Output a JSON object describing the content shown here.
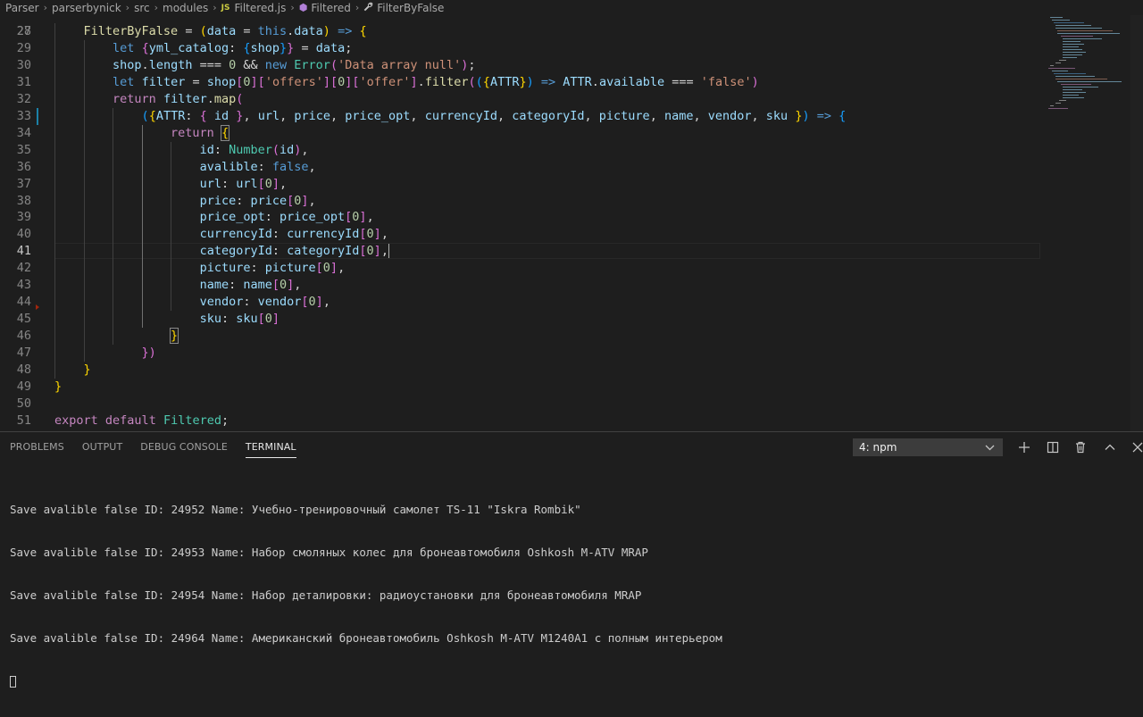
{
  "breadcrumb": {
    "items": [
      "Parser",
      "parserbynick",
      "src",
      "modules"
    ],
    "file_badge": "JS",
    "file": "Filtered.js",
    "class": "Filtered",
    "method": "FilterByFalse"
  },
  "editor": {
    "first_line_number": "27",
    "lines": [
      {
        "n": "28",
        "tokens": [
          [
            "p",
            "    "
          ],
          [
            "fn",
            "FilterByFalse"
          ],
          [
            "p",
            " = "
          ],
          [
            "br1",
            "("
          ],
          [
            "var",
            "data"
          ],
          [
            "p",
            " = "
          ],
          [
            "kw",
            "this"
          ],
          [
            "p",
            "."
          ],
          [
            "var",
            "data"
          ],
          [
            "br1",
            ")"
          ],
          [
            "p",
            " "
          ],
          [
            "kw",
            "=>"
          ],
          [
            "p",
            " "
          ],
          [
            "br1",
            "{"
          ]
        ]
      },
      {
        "n": "29",
        "tokens": [
          [
            "p",
            "        "
          ],
          [
            "kw",
            "let"
          ],
          [
            "p",
            " "
          ],
          [
            "br2",
            "{"
          ],
          [
            "var",
            "yml_catalog"
          ],
          [
            "p",
            ": "
          ],
          [
            "br3",
            "{"
          ],
          [
            "var",
            "shop"
          ],
          [
            "br3",
            "}"
          ],
          [
            "br2",
            "}"
          ],
          [
            "p",
            " = "
          ],
          [
            "var",
            "data"
          ],
          [
            "p",
            ";"
          ]
        ]
      },
      {
        "n": "30",
        "tokens": [
          [
            "p",
            "        "
          ],
          [
            "var",
            "shop"
          ],
          [
            "p",
            "."
          ],
          [
            "var",
            "length"
          ],
          [
            "p",
            " === "
          ],
          [
            "num",
            "0"
          ],
          [
            "p",
            " && "
          ],
          [
            "kw",
            "new"
          ],
          [
            "p",
            " "
          ],
          [
            "cls",
            "Error"
          ],
          [
            "br2",
            "("
          ],
          [
            "str",
            "'Data array null'"
          ],
          [
            "br2",
            ")"
          ],
          [
            "p",
            ";"
          ]
        ]
      },
      {
        "n": "31",
        "tokens": [
          [
            "p",
            "        "
          ],
          [
            "kw",
            "let"
          ],
          [
            "p",
            " "
          ],
          [
            "var",
            "filter"
          ],
          [
            "p",
            " = "
          ],
          [
            "var",
            "shop"
          ],
          [
            "br2",
            "["
          ],
          [
            "num",
            "0"
          ],
          [
            "br2",
            "]"
          ],
          [
            "br2",
            "["
          ],
          [
            "str",
            "'offers'"
          ],
          [
            "br2",
            "]"
          ],
          [
            "br2",
            "["
          ],
          [
            "num",
            "0"
          ],
          [
            "br2",
            "]"
          ],
          [
            "br2",
            "["
          ],
          [
            "str",
            "'offer'"
          ],
          [
            "br2",
            "]"
          ],
          [
            "p",
            "."
          ],
          [
            "fn",
            "filter"
          ],
          [
            "br2",
            "("
          ],
          [
            "br3",
            "("
          ],
          [
            "br1",
            "{"
          ],
          [
            "var",
            "ATTR"
          ],
          [
            "br1",
            "}"
          ],
          [
            "br3",
            ")"
          ],
          [
            "p",
            " "
          ],
          [
            "kw",
            "=>"
          ],
          [
            "p",
            " "
          ],
          [
            "var",
            "ATTR"
          ],
          [
            "p",
            "."
          ],
          [
            "var",
            "available"
          ],
          [
            "p",
            " === "
          ],
          [
            "str",
            "'false'"
          ],
          [
            "br2",
            ")"
          ]
        ]
      },
      {
        "n": "32",
        "tokens": [
          [
            "p",
            "        "
          ],
          [
            "fl",
            "return"
          ],
          [
            "p",
            " "
          ],
          [
            "var",
            "filter"
          ],
          [
            "p",
            "."
          ],
          [
            "fn",
            "map"
          ],
          [
            "br2",
            "("
          ]
        ]
      },
      {
        "n": "33",
        "tokens": [
          [
            "p",
            "            "
          ],
          [
            "br3",
            "("
          ],
          [
            "br1",
            "{"
          ],
          [
            "var",
            "ATTR"
          ],
          [
            "p",
            ": "
          ],
          [
            "br2",
            "{"
          ],
          [
            "p",
            " "
          ],
          [
            "var",
            "id"
          ],
          [
            "p",
            " "
          ],
          [
            "br2",
            "}"
          ],
          [
            "p",
            ", "
          ],
          [
            "var",
            "url"
          ],
          [
            "p",
            ", "
          ],
          [
            "var",
            "price"
          ],
          [
            "p",
            ", "
          ],
          [
            "var",
            "price_opt"
          ],
          [
            "p",
            ", "
          ],
          [
            "var",
            "currencyId"
          ],
          [
            "p",
            ", "
          ],
          [
            "var",
            "categoryId"
          ],
          [
            "p",
            ", "
          ],
          [
            "var",
            "picture"
          ],
          [
            "p",
            ", "
          ],
          [
            "var",
            "name"
          ],
          [
            "p",
            ", "
          ],
          [
            "var",
            "vendor"
          ],
          [
            "p",
            ", "
          ],
          [
            "var",
            "sku"
          ],
          [
            "p",
            " "
          ],
          [
            "br1",
            "}"
          ],
          [
            "br3",
            ")"
          ],
          [
            "p",
            " "
          ],
          [
            "kw",
            "=>"
          ],
          [
            "p",
            " "
          ],
          [
            "br3",
            "{"
          ]
        ]
      },
      {
        "n": "34",
        "tokens": [
          [
            "p",
            "                "
          ],
          [
            "fl",
            "return"
          ],
          [
            "p",
            " "
          ],
          [
            "br1box",
            "{"
          ]
        ]
      },
      {
        "n": "35",
        "tokens": [
          [
            "p",
            "                    "
          ],
          [
            "var",
            "id"
          ],
          [
            "p",
            ": "
          ],
          [
            "cls",
            "Number"
          ],
          [
            "br2",
            "("
          ],
          [
            "var",
            "id"
          ],
          [
            "br2",
            ")"
          ],
          [
            "p",
            ","
          ]
        ]
      },
      {
        "n": "36",
        "tokens": [
          [
            "p",
            "                    "
          ],
          [
            "var",
            "avalible"
          ],
          [
            "p",
            ": "
          ],
          [
            "kw",
            "false"
          ],
          [
            "p",
            ","
          ]
        ]
      },
      {
        "n": "37",
        "tokens": [
          [
            "p",
            "                    "
          ],
          [
            "var",
            "url"
          ],
          [
            "p",
            ": "
          ],
          [
            "var",
            "url"
          ],
          [
            "br2",
            "["
          ],
          [
            "num",
            "0"
          ],
          [
            "br2",
            "]"
          ],
          [
            "p",
            ","
          ]
        ]
      },
      {
        "n": "38",
        "tokens": [
          [
            "p",
            "                    "
          ],
          [
            "var",
            "price"
          ],
          [
            "p",
            ": "
          ],
          [
            "var",
            "price"
          ],
          [
            "br2",
            "["
          ],
          [
            "num",
            "0"
          ],
          [
            "br2",
            "]"
          ],
          [
            "p",
            ","
          ]
        ]
      },
      {
        "n": "39",
        "tokens": [
          [
            "p",
            "                    "
          ],
          [
            "var",
            "price_opt"
          ],
          [
            "p",
            ": "
          ],
          [
            "var",
            "price_opt"
          ],
          [
            "br2",
            "["
          ],
          [
            "num",
            "0"
          ],
          [
            "br2",
            "]"
          ],
          [
            "p",
            ","
          ]
        ]
      },
      {
        "n": "40",
        "tokens": [
          [
            "p",
            "                    "
          ],
          [
            "var",
            "currencyId"
          ],
          [
            "p",
            ": "
          ],
          [
            "var",
            "currencyId"
          ],
          [
            "br2",
            "["
          ],
          [
            "num",
            "0"
          ],
          [
            "br2",
            "]"
          ],
          [
            "p",
            ","
          ]
        ]
      },
      {
        "n": "41",
        "tokens": [
          [
            "p",
            "                    "
          ],
          [
            "var",
            "categoryId"
          ],
          [
            "p",
            ": "
          ],
          [
            "var",
            "categoryId"
          ],
          [
            "br2",
            "["
          ],
          [
            "num",
            "0"
          ],
          [
            "br2",
            "]"
          ],
          [
            "p",
            ","
          ],
          [
            "caret",
            ""
          ]
        ]
      },
      {
        "n": "42",
        "tokens": [
          [
            "p",
            "                    "
          ],
          [
            "var",
            "picture"
          ],
          [
            "p",
            ": "
          ],
          [
            "var",
            "picture"
          ],
          [
            "br2",
            "["
          ],
          [
            "num",
            "0"
          ],
          [
            "br2",
            "]"
          ],
          [
            "p",
            ","
          ]
        ]
      },
      {
        "n": "43",
        "tokens": [
          [
            "p",
            "                    "
          ],
          [
            "var",
            "name"
          ],
          [
            "p",
            ": "
          ],
          [
            "var",
            "name"
          ],
          [
            "br2",
            "["
          ],
          [
            "num",
            "0"
          ],
          [
            "br2",
            "]"
          ],
          [
            "p",
            ","
          ]
        ]
      },
      {
        "n": "44",
        "tokens": [
          [
            "p",
            "                    "
          ],
          [
            "var",
            "vendor"
          ],
          [
            "p",
            ": "
          ],
          [
            "var",
            "vendor"
          ],
          [
            "br2",
            "["
          ],
          [
            "num",
            "0"
          ],
          [
            "br2",
            "]"
          ],
          [
            "p",
            ","
          ]
        ]
      },
      {
        "n": "45",
        "tokens": [
          [
            "p",
            "                    "
          ],
          [
            "var",
            "sku"
          ],
          [
            "p",
            ": "
          ],
          [
            "var",
            "sku"
          ],
          [
            "br2",
            "["
          ],
          [
            "num",
            "0"
          ],
          [
            "br2",
            "]"
          ]
        ]
      },
      {
        "n": "46",
        "tokens": [
          [
            "p",
            "                "
          ],
          [
            "br1box",
            "}"
          ]
        ]
      },
      {
        "n": "47",
        "tokens": [
          [
            "p",
            "            "
          ],
          [
            "br2",
            "})"
          ]
        ]
      },
      {
        "n": "48",
        "tokens": [
          [
            "p",
            "    "
          ],
          [
            "br1",
            "}"
          ]
        ]
      },
      {
        "n": "49",
        "tokens": [
          [
            "br1",
            "}"
          ]
        ]
      },
      {
        "n": "50",
        "tokens": []
      },
      {
        "n": "51",
        "tokens": [
          [
            "fl",
            "export"
          ],
          [
            "p",
            " "
          ],
          [
            "fl",
            "default"
          ],
          [
            "p",
            " "
          ],
          [
            "cls",
            "Filtered"
          ],
          [
            "p",
            ";"
          ]
        ]
      }
    ],
    "active_line": "41"
  },
  "panel": {
    "tabs": [
      "PROBLEMS",
      "OUTPUT",
      "DEBUG CONSOLE",
      "TERMINAL"
    ],
    "active_tab": "TERMINAL",
    "terminal_select": "4: npm",
    "terminal_lines": [
      "Save avalible false ID: 24952 Name: Учебно-тренировочный самолет TS-11 \"Iskra Rombik\"",
      "Save avalible false ID: 24953 Name: Набор смоляных колес для бронеавтомобиля Oshkosh M-ATV MRAP",
      "Save avalible false ID: 24954 Name: Набор деталировки: радиоустановки для бронеавтомобиля MRAP",
      "Save avalible false ID: 24964 Name: Американский бронеавтомобиль Oshkosh M-ATV M1240A1 с полным интерьером"
    ]
  },
  "colors": {
    "background": "#1e1e1e",
    "keyword": "#569cd6",
    "control": "#c586c0",
    "variable": "#9cdcfe",
    "function": "#dcdcaa",
    "class": "#4ec9b0",
    "string": "#ce9178",
    "number": "#b5cea8"
  }
}
